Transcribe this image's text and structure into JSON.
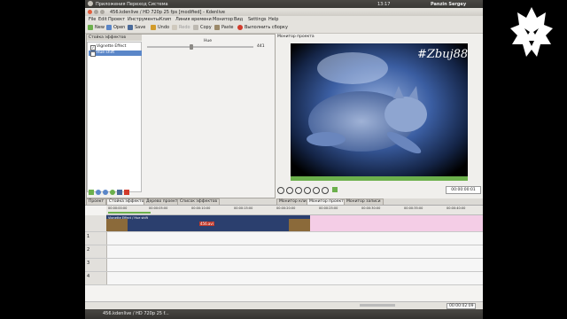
{
  "top_panel": {
    "left_menu": "Приложения  Переход  Система",
    "time": "13:17",
    "user": "Panzin Sergey"
  },
  "window": {
    "title": "456.kdenlive / HD 720p 25 fps [modified] - Kdenlive"
  },
  "menu": [
    "File",
    "Edit",
    "Проект",
    "Инструменты",
    "Клип",
    "Линия времени",
    "Монитор",
    "Вид",
    "Settings",
    "Help"
  ],
  "toolbar": {
    "new": "New",
    "open": "Open",
    "save": "Save",
    "undo": "Undo",
    "redo": "Redo",
    "copy": "Copy",
    "paste": "Paste",
    "render": "Выполнить сборку"
  },
  "effects_stack": {
    "tab": "Стойка эффектов",
    "items": [
      {
        "label": "Vignette Effect",
        "checked": true
      },
      {
        "label": "Hue shift",
        "checked": true
      }
    ],
    "param_label": "Hue",
    "param_value": "441"
  },
  "left_tabs": [
    "Проект",
    "Стойка эффектов",
    "Дерево проекта",
    "Список эффектов"
  ],
  "monitor": {
    "title": "Монитор проекта",
    "timecode": "00:00:00:01",
    "tabs": [
      "Монитор клипа",
      "Монитор проекта",
      "Монитор записи"
    ]
  },
  "watermark": "#Zbuj88",
  "timeline": {
    "ruler": [
      "00:00:00:00",
      "00:00:05:00",
      "00:00:10:00",
      "00:00:15:00",
      "00:00:20:00",
      "00:00:25:00",
      "00:00:30:00",
      "00:00:35:00",
      "00:00:40:00"
    ],
    "clip_label": "Vignette Effect / Hue shift",
    "clip_name": "456.avi",
    "track_numbers": [
      "1",
      "2",
      "3",
      "4"
    ],
    "timecode": "00:00:02:09"
  },
  "taskbar": {
    "item": "456.kdenlive / HD 720p 25 f..."
  },
  "colors": {
    "panel": "#3a3936",
    "clip": "#2b3f6e",
    "audio_track": "#f4cde6",
    "selection": "#5a86c8"
  }
}
